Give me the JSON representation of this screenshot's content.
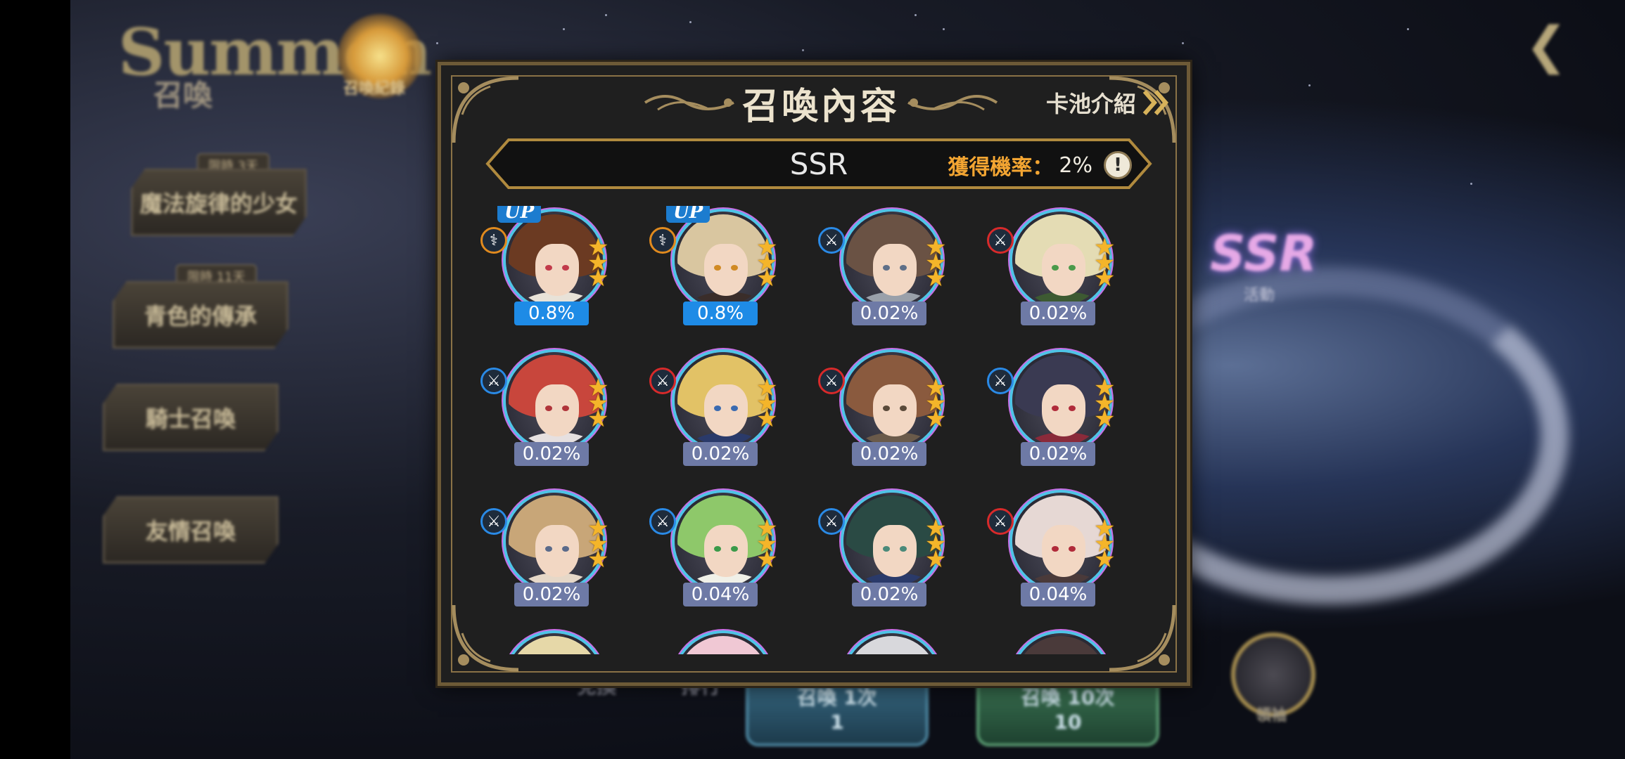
{
  "background": {
    "title": "Summon",
    "subtitle": "召喚",
    "history_label": "召喚紀錄",
    "side_tabs": [
      {
        "tag": "限時 3天",
        "label": "魔法旋律的少女"
      },
      {
        "tag": "限時 11天",
        "label": "青色的傳承"
      },
      {
        "tag": "",
        "label": "騎士召喚"
      },
      {
        "tag": "",
        "label": "友情召喚"
      }
    ],
    "bottom_left_label": "兌換",
    "bottom_rank_label": "排行",
    "summon_once_label": "召喚 1次",
    "summon_once_cost": "1",
    "summon_ten_label": "召喚 10次",
    "summon_ten_cost": "10",
    "emblem_label": "領袖",
    "ssr_label": "SSR",
    "ssr_sub": "活動"
  },
  "dialog": {
    "title": "召喚內容",
    "pool_info_label": "卡池介紹",
    "rarity": "SSR",
    "rate_label": "獲得機率：",
    "rate_value": "2%",
    "colors": {
      "up_badge": "#1e8be6",
      "normal_badge": "#6e7aa6",
      "star": "#f4b52a",
      "rate_label": "#f3a532"
    },
    "characters": [
      {
        "rate": "0.8%",
        "up": true,
        "up_label": "UP",
        "class_icon": "staff-icon",
        "class_color": "#e08a1e",
        "hair": "#6b3a22",
        "eye": "#c23a4a",
        "outfit": "#e8e2d8"
      },
      {
        "rate": "0.8%",
        "up": true,
        "up_label": "UP",
        "class_icon": "staff-icon",
        "class_color": "#e08a1e",
        "hair": "#d9c6a0",
        "eye": "#d08a24",
        "outfit": "#3a2d2a"
      },
      {
        "rate": "0.02%",
        "up": false,
        "class_icon": "sword-icon",
        "class_color": "#2a8ae6",
        "hair": "#6a5244",
        "eye": "#5f6f88",
        "outfit": "#9aa0aa"
      },
      {
        "rate": "0.02%",
        "up": false,
        "class_icon": "sword-icon",
        "class_color": "#d82a2a",
        "hair": "#e4dcb4",
        "eye": "#4a9a4a",
        "outfit": "#3d5a32"
      },
      {
        "rate": "0.02%",
        "up": false,
        "class_icon": "sword-icon",
        "class_color": "#2a8ae6",
        "hair": "#c8463c",
        "eye": "#b0343a",
        "outfit": "#e6e0e0"
      },
      {
        "rate": "0.02%",
        "up": false,
        "class_icon": "sword-icon",
        "class_color": "#d82a2a",
        "hair": "#e2c266",
        "eye": "#3a6ab0",
        "outfit": "#2a3a6a"
      },
      {
        "rate": "0.02%",
        "up": false,
        "class_icon": "sword-icon",
        "class_color": "#d82a2a",
        "hair": "#8a5a3e",
        "eye": "#5a4a3a",
        "outfit": "#6a5a4a"
      },
      {
        "rate": "0.02%",
        "up": false,
        "class_icon": "sword-icon",
        "class_color": "#2a8ae6",
        "hair": "#3a3a52",
        "eye": "#b02a3a",
        "outfit": "#8a2a3a"
      },
      {
        "rate": "0.02%",
        "up": false,
        "class_icon": "sword-icon",
        "class_color": "#2a8ae6",
        "hair": "#c8a678",
        "eye": "#5a6a8a",
        "outfit": "#e6d8c8"
      },
      {
        "rate": "0.04%",
        "up": false,
        "class_icon": "sword-icon",
        "class_color": "#2a8ae6",
        "hair": "#8ec86a",
        "eye": "#3a9a4a",
        "outfit": "#f0f0e8"
      },
      {
        "rate": "0.02%",
        "up": false,
        "class_icon": "sword-icon",
        "class_color": "#2a8ae6",
        "hair": "#2a4a44",
        "eye": "#4a8a7a",
        "outfit": "#2a3a6a"
      },
      {
        "rate": "0.04%",
        "up": false,
        "class_icon": "sword-icon",
        "class_color": "#d82a2a",
        "hair": "#e6d8d4",
        "eye": "#b02a3a",
        "outfit": "#4a3a3a"
      },
      {
        "rate": "",
        "up": false,
        "class_icon": "",
        "class_color": "#2a8ae6",
        "hair": "#e6d8a8",
        "eye": "#5a6a8a",
        "outfit": "#e6e0d8"
      },
      {
        "rate": "",
        "up": false,
        "class_icon": "",
        "class_color": "#2a8ae6",
        "hair": "#f0c8d4",
        "eye": "#5a6a8a",
        "outfit": "#e6e0d8"
      },
      {
        "rate": "",
        "up": false,
        "class_icon": "",
        "class_color": "#2a8ae6",
        "hair": "#d8d8dc",
        "eye": "#5a6a8a",
        "outfit": "#e6e0d8"
      },
      {
        "rate": "",
        "up": false,
        "class_icon": "",
        "class_color": "#2a8ae6",
        "hair": "#4a3a3a",
        "eye": "#5a6a8a",
        "outfit": "#e6e0d8"
      }
    ]
  }
}
